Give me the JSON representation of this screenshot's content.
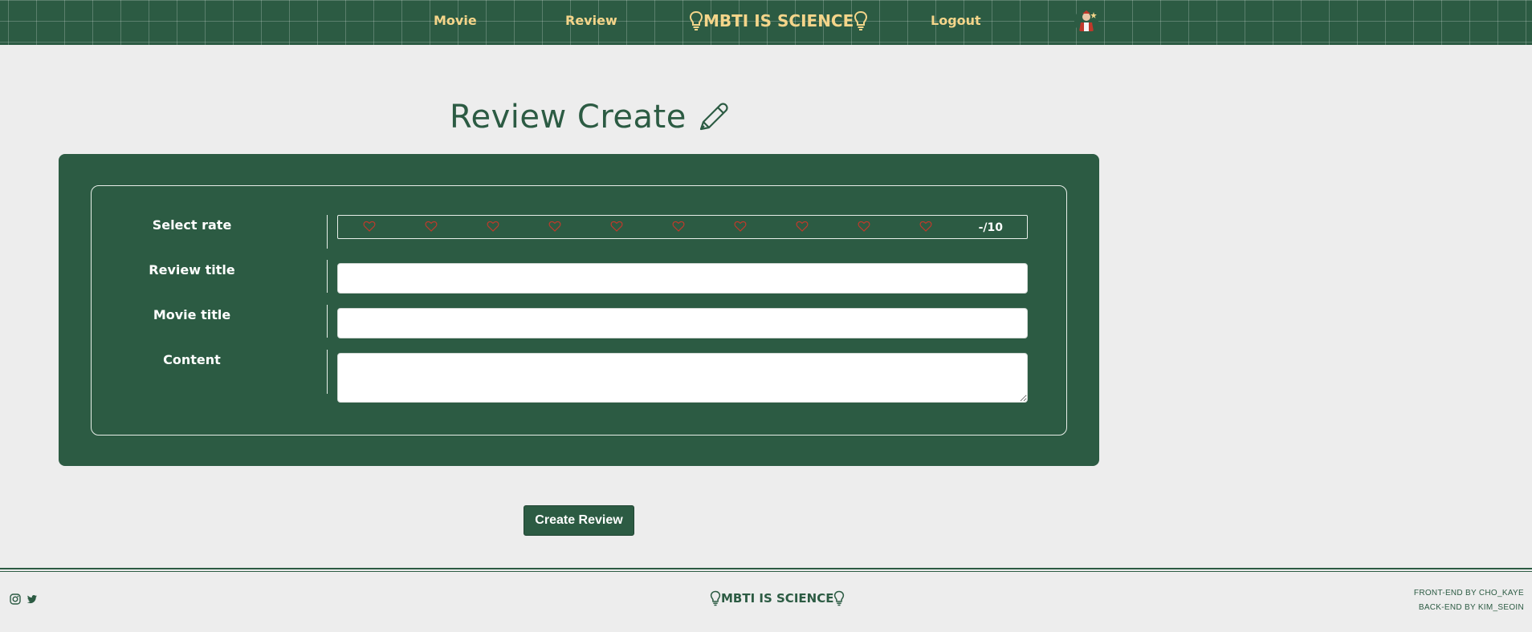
{
  "header": {
    "nav": {
      "movie": "Movie",
      "review": "Review",
      "logout": "Logout"
    },
    "brand": "MBTI IS SCIENCE",
    "brand_icon": "lightbulb-icon",
    "avatar_icon": "user-avatar"
  },
  "page": {
    "title": "Review Create",
    "title_icon": "pen-icon"
  },
  "form": {
    "labels": {
      "rate": "Select rate",
      "review_title": "Review title",
      "movie_title": "Movie title",
      "content": "Content"
    },
    "rate": {
      "max": 10,
      "display": "-/10",
      "icon": "heart-outline-icon"
    },
    "fields": {
      "review_title": "",
      "movie_title": "",
      "content": ""
    },
    "submit_label": "Create Review"
  },
  "footer": {
    "brand": "MBTI IS SCIENCE",
    "social": [
      "instagram-icon",
      "twitter-icon"
    ],
    "credits": [
      "FRONT-END BY CHO_KAYE",
      "BACK-END BY KIM_SEOIN"
    ]
  },
  "colors": {
    "primary": "#2c5b43",
    "accent": "#f4d58a",
    "background": "#ededed",
    "heart": "#c0392b"
  }
}
